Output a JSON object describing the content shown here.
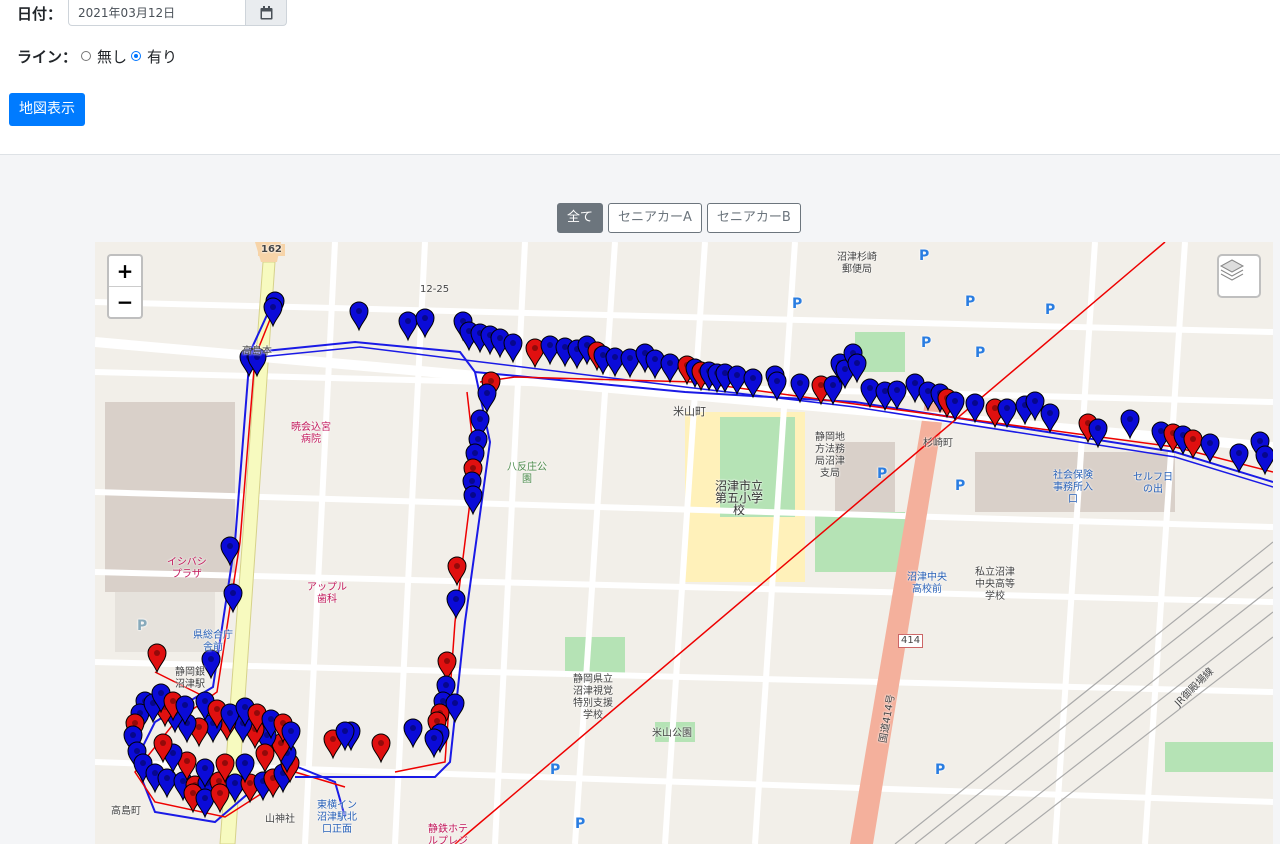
{
  "form": {
    "date_label": "日付：",
    "date_value": "2021年03月12日",
    "line_label": "ライン：",
    "line_options": {
      "none": "無し",
      "yes": "有り"
    },
    "line_selected": "有り",
    "show_button": "地図表示"
  },
  "filters": {
    "all": "全て",
    "car_a": "セニアカーA",
    "car_b": "セニアカーB",
    "selected": "全て"
  },
  "map": {
    "zoom_in": "+",
    "zoom_out": "−",
    "labels": {
      "road_162": "162",
      "coord": "12-25",
      "takashimamoto": "高島本",
      "hospital": "暁会込宮\n病院",
      "hachitan_park": "八反庄公\n園",
      "yoneyama": "米山町",
      "school": "沼津市立\n第五小学\n校",
      "legal_bureau": "静岡地\n方法務\n局沼津\n支局",
      "suginosaki": "杉崎町",
      "numazu_suginosaki_post": "沼津杉崎\n郵便局",
      "social_insurance": "社会保険\n事務所入\n口",
      "self_station": "セルフ日\nの出",
      "private_highschool": "私立沼津\n中央高等\n学校",
      "chuo_stop": "沼津中央\n高校前",
      "apple_dental": "アップル\n歯科",
      "ishibashi_plaza": "イシバシ\nプラザ",
      "prefectural_office": "県総合庁\n舎前",
      "shizuoka_bank": "静岡銀\n沼津駅",
      "prefectural_school": "静岡県立\n沼津視覚\n特別支援\n学校",
      "yoneyama_park": "米山公園",
      "route_414": "414",
      "route_414_name": "国道414号",
      "jr_line": "JR御殿場線",
      "takashimacho": "高島町",
      "toyoko_inn": "東横イン\n沼津駅北\n口正面",
      "shrine": "山神社",
      "hotel": "静鉄ホテ\nルプレジ",
      "parking": "P"
    }
  }
}
